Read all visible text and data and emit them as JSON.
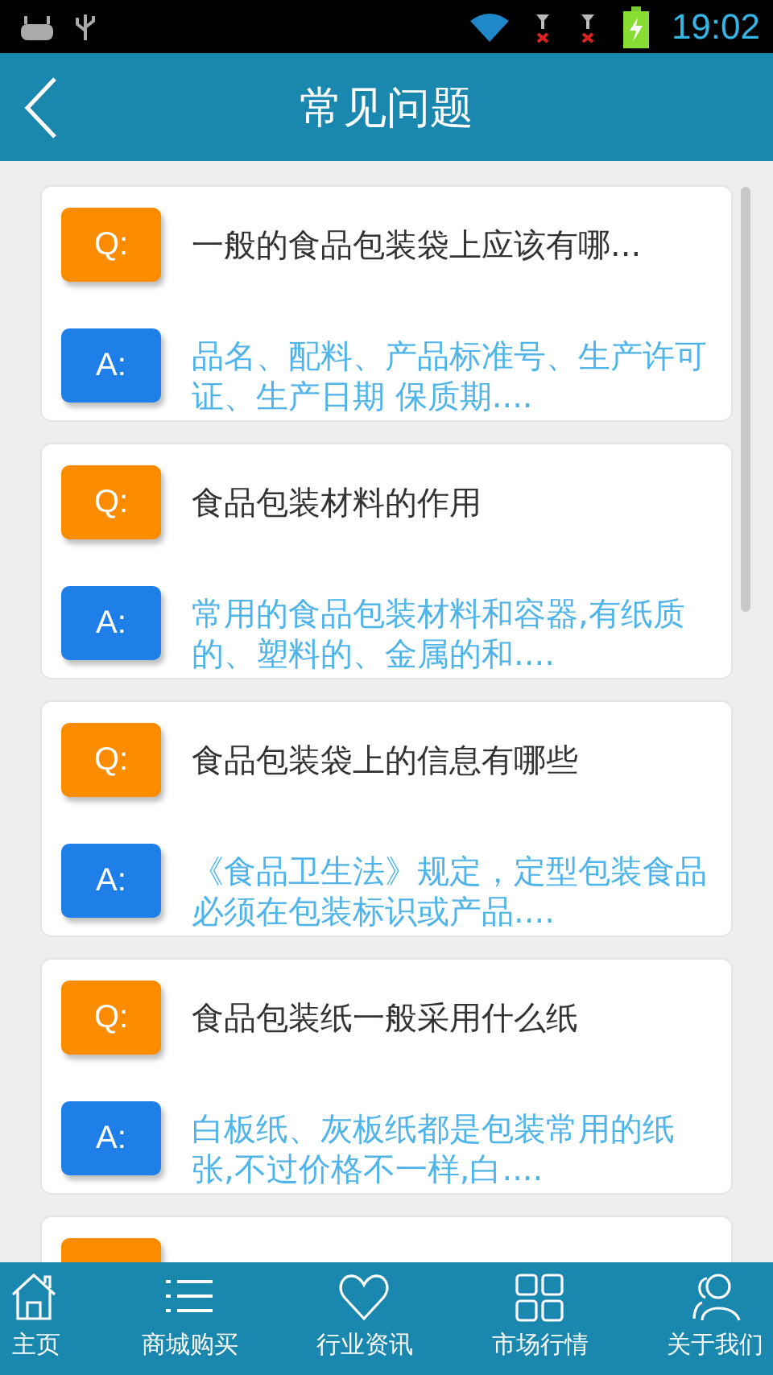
{
  "status_bar": {
    "time": "19:02"
  },
  "header": {
    "title": "常见问题"
  },
  "faqs": [
    {
      "q_badge": "Q:",
      "question": "一般的食品包装袋上应该有哪...",
      "a_badge": "A:",
      "answer": "品名、配料、产品标准号、生产许可证、生产日期 保质期...."
    },
    {
      "q_badge": "Q:",
      "question": "食品包装材料的作用",
      "a_badge": "A:",
      "answer": "常用的食品包装材料和容器,有纸质的、塑料的、金属的和...."
    },
    {
      "q_badge": "Q:",
      "question": "食品包装袋上的信息有哪些",
      "a_badge": "A:",
      "answer": "《食品卫生法》规定，定型包装食品必须在包装标识或产品...."
    },
    {
      "q_badge": "Q:",
      "question": "食品包装纸一般采用什么纸",
      "a_badge": "A:",
      "answer": "白板纸、灰板纸都是包装常用的纸张,不过价格不一样,白...."
    }
  ],
  "nav": [
    {
      "kind": "home",
      "label": "主页"
    },
    {
      "kind": "list",
      "label": "商城购买"
    },
    {
      "kind": "heart",
      "label": "行业资讯"
    },
    {
      "kind": "grid",
      "label": "市场行情"
    },
    {
      "kind": "people",
      "label": "关于我们"
    }
  ]
}
